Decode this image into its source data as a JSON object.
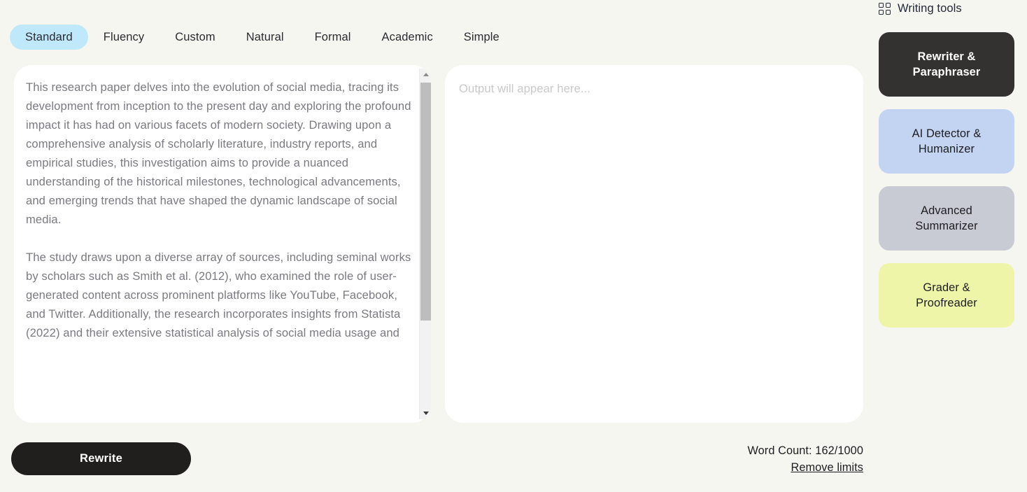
{
  "tabs": {
    "items": [
      {
        "label": "Standard",
        "active": true
      },
      {
        "label": "Fluency",
        "active": false
      },
      {
        "label": "Custom",
        "active": false
      },
      {
        "label": "Natural",
        "active": false
      },
      {
        "label": "Formal",
        "active": false
      },
      {
        "label": "Academic",
        "active": false
      },
      {
        "label": "Simple",
        "active": false
      }
    ]
  },
  "editor": {
    "paragraphs": [
      "This research paper delves into the evolution of social media, tracing its development from inception to the present day and exploring the profound impact it has had on various facets of modern society. Drawing upon a comprehensive analysis of scholarly literature, industry reports, and empirical studies, this investigation aims to provide a nuanced understanding of the historical milestones, technological advancements, and emerging trends that have shaped the dynamic landscape of social media.",
      "The study draws upon a diverse array of sources, including seminal works by scholars such as Smith et al. (2012), who examined the role of user-generated content across prominent platforms like YouTube, Facebook, and Twitter. Additionally, the research incorporates insights from Statista (2022) and their extensive statistical analysis of social media usage and"
    ],
    "scrollbar": {
      "up_arrow": "▲",
      "down_arrow": "▼"
    }
  },
  "output": {
    "placeholder": "Output will appear here..."
  },
  "actions": {
    "rewrite_label": "Rewrite"
  },
  "status": {
    "word_count": "Word Count: 162/1000",
    "remove_limits": "Remove limits"
  },
  "sidebar": {
    "title": "Writing tools",
    "icon": "grid-icon",
    "tools": [
      {
        "label": "Rewriter & Paraphraser",
        "bg": "#343231",
        "color": "#ffffff",
        "bold": true
      },
      {
        "label": "AI Detector & Humanizer",
        "bg": "#c3d4f2",
        "color": "#1d1d21",
        "bold": false
      },
      {
        "label": "Advanced Summarizer",
        "bg": "#c9cbd4",
        "color": "#1d1d21",
        "bold": false
      },
      {
        "label": "Grader & Proofreader",
        "bg": "#eff5a8",
        "color": "#1d1d21",
        "bold": false
      }
    ]
  },
  "colors": {
    "page_bg": "#f6f6f1",
    "panel_bg": "#ffffff",
    "active_tab_bg": "#bfe8fb",
    "accent_dark": "#211f1e"
  }
}
